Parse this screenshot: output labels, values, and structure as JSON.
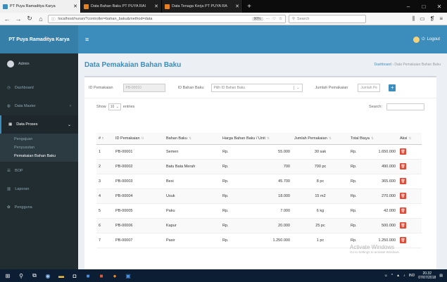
{
  "browser": {
    "tabs": [
      {
        "title": "PT Puya Ramaditya Karya",
        "active": true,
        "favicon_color": "#3c8dbc"
      },
      {
        "title": "Data Bahan Baku PT PUYA RAI",
        "active": false,
        "favicon_color": "#e67e22"
      },
      {
        "title": "Data Tenaga Kerja PT PUYA RA",
        "active": false,
        "favicon_color": "#e67e22"
      }
    ],
    "url": "localhost/nuran/?controller=bahan_baku&method=data",
    "zoom": "90%",
    "search_placeholder": "Search"
  },
  "app": {
    "brand": "PT Puya Ramaditya Karya",
    "logout_label": "Logout",
    "user_name": "Admin"
  },
  "sidebar": {
    "items": [
      {
        "label": "Dashboard",
        "icon": "dashboard-icon"
      },
      {
        "label": "Data Master",
        "icon": "database-icon"
      },
      {
        "label": "Data Proses",
        "icon": "table-icon"
      },
      {
        "label": "BOP",
        "icon": "list-icon"
      },
      {
        "label": "Laporan",
        "icon": "chart-icon"
      },
      {
        "label": "Pengguna",
        "icon": "users-icon"
      }
    ],
    "submenu": [
      "Pengajuan",
      "Penyusutan",
      "Pemakaian Bahan Baku"
    ]
  },
  "page": {
    "title": "Data Pemakaian Bahan Baku",
    "breadcrumb_home": "Dashboard",
    "breadcrumb_current": "Data Pemakaian Bahan Baku"
  },
  "form": {
    "id_pemakaian_label": "ID Pemakaian",
    "id_pemakaian_value": "PB-00010",
    "id_bahan_label": "ID Bahan Baku",
    "id_bahan_placeholder": "Pilih ID Bahan Baku",
    "jumlah_label": "Jumlah Pemakaian",
    "jumlah_placeholder": "Jumlah Pe"
  },
  "table_tools": {
    "show_label": "Show",
    "entries_value": "10",
    "entries_label": "entries",
    "search_label": "Search:"
  },
  "table": {
    "headers": [
      "# ↑",
      "ID Pemakaian",
      "Bahan Baku",
      "Harga Bahan Baku / Unit",
      "Jumlah Pemakaian",
      "Total Biaya",
      "Aksi"
    ],
    "rows": [
      {
        "no": "1",
        "id": "PB-00001",
        "bahan": "Semen",
        "cur1": "Rp.",
        "harga": "55.000",
        "jumlah": "30 sak",
        "cur2": "Rp.",
        "total": "1.650.000"
      },
      {
        "no": "2",
        "id": "PB-00002",
        "bahan": "Batu Bata Merah",
        "cur1": "Rp.",
        "harga": "700",
        "jumlah": "700 pc",
        "cur2": "Rp.",
        "total": "490.000"
      },
      {
        "no": "3",
        "id": "PB-00003",
        "bahan": "Besi",
        "cur1": "Rp.",
        "harga": "45.700",
        "jumlah": "8 pc",
        "cur2": "Rp.",
        "total": "365.600"
      },
      {
        "no": "4",
        "id": "PB-00004",
        "bahan": "Usuk",
        "cur1": "Rp.",
        "harga": "18.000",
        "jumlah": "15 m2",
        "cur2": "Rp.",
        "total": "270.000"
      },
      {
        "no": "5",
        "id": "PB-00005",
        "bahan": "Paku",
        "cur1": "Rp.",
        "harga": "7.000",
        "jumlah": "6 kg",
        "cur2": "Rp.",
        "total": "42.000"
      },
      {
        "no": "6",
        "id": "PB-00006",
        "bahan": "Kapur",
        "cur1": "Rp.",
        "harga": "20.000",
        "jumlah": "25 pc",
        "cur2": "Rp.",
        "total": "500.000"
      },
      {
        "no": "7",
        "id": "PB-00007",
        "bahan": "Pasir",
        "cur1": "Rp.",
        "harga": "1.250.000",
        "jumlah": "1 pc",
        "cur2": "Rp.",
        "total": "1.250.000"
      }
    ]
  },
  "watermark": {
    "title": "Activate Windows",
    "subtitle": "Go to Settings to activate Windows."
  },
  "taskbar": {
    "time": "20.32",
    "date": "07/07/2018",
    "lang": "IND"
  },
  "colors": {
    "primary": "#3c8dbc",
    "sidebar_bg": "#222d32",
    "danger": "#dd4b39"
  }
}
